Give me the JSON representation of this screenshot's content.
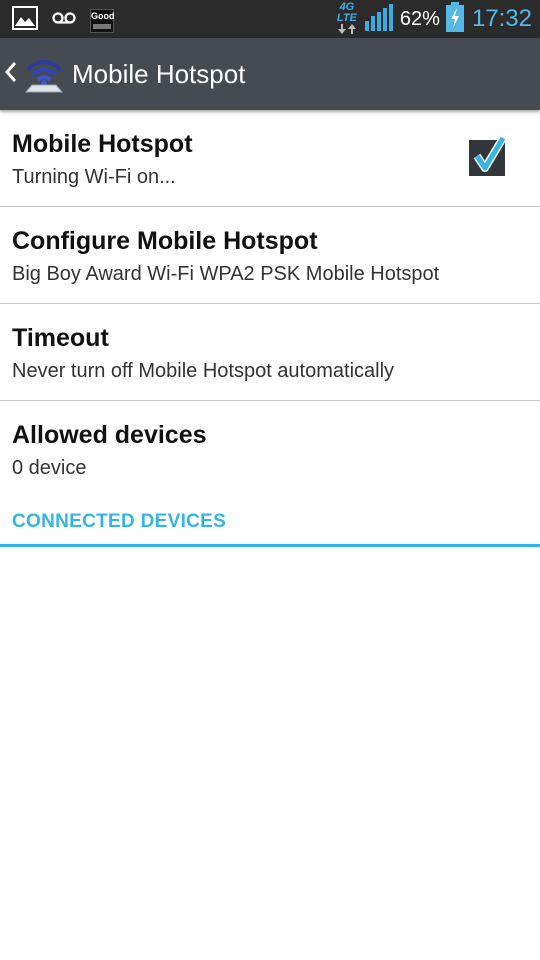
{
  "status_bar": {
    "network_type_top": "4G",
    "network_type_bottom": "LTE",
    "good_badge": "Good",
    "battery_percent": "62%",
    "time": "17:32",
    "icons": [
      "gallery-notification-icon",
      "voicemail-icon",
      "good-app-icon",
      "data-arrows-icon",
      "signal-bars-icon",
      "battery-charging-icon"
    ]
  },
  "action_bar": {
    "title": "Mobile Hotspot"
  },
  "settings": {
    "hotspot": {
      "title": "Mobile Hotspot",
      "summary": "Turning Wi-Fi on...",
      "checked": true
    },
    "configure": {
      "title": "Configure Mobile Hotspot",
      "summary": "Big Boy Award Wi-Fi WPA2 PSK Mobile Hotspot"
    },
    "timeout": {
      "title": "Timeout",
      "summary": "Never turn off Mobile Hotspot automatically"
    },
    "allowed": {
      "title": "Allowed devices",
      "summary": "0 device"
    }
  },
  "section": {
    "connected_devices": "CONNECTED DEVICES"
  },
  "colors": {
    "accent": "#33b5e5",
    "action_bar": "#464b52",
    "status_bar": "#2b2b2b"
  }
}
